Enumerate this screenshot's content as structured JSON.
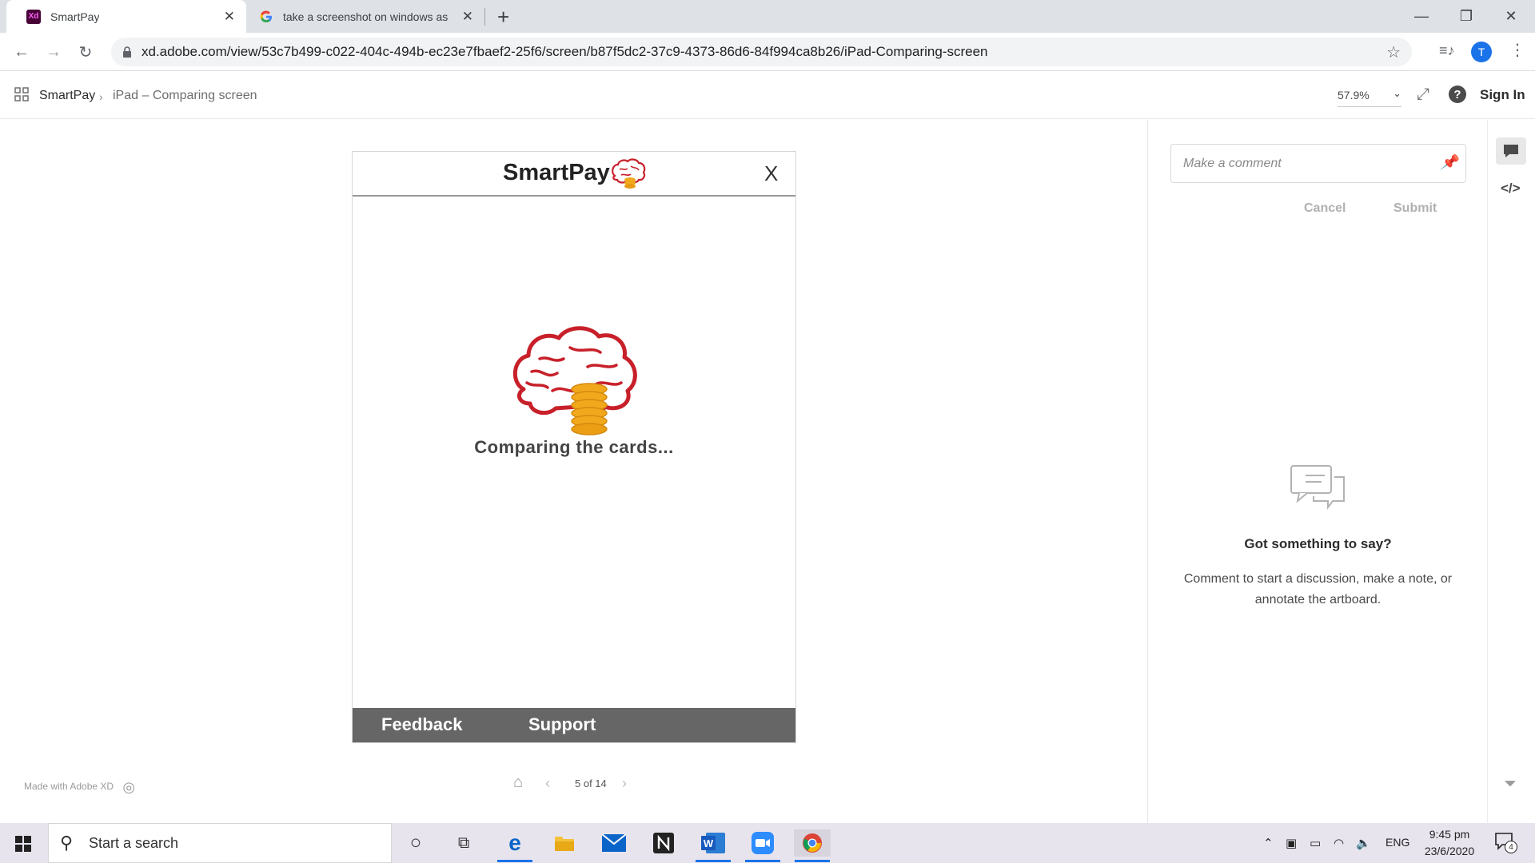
{
  "browser": {
    "tabs": [
      {
        "title": "SmartPay",
        "favicon": "Xd"
      },
      {
        "title": "take a screenshot on windows as",
        "favicon": "google-icon"
      }
    ],
    "url": "xd.adobe.com/view/53c7b499-c022-404c-494b-ec23e7fbaef2-25f6/screen/b87f5dc2-37c9-4373-86d6-84f994ca8b26/iPad-Comparing-screen",
    "profile_initial": "T"
  },
  "xd": {
    "breadcrumb": {
      "root": "SmartPay",
      "current": "iPad – Comparing screen"
    },
    "zoom": "57.9%",
    "sign_in": "Sign In",
    "made_with": "Made with Adobe XD",
    "pager": "5 of 14"
  },
  "artboard": {
    "title": "SmartPay",
    "close": "X",
    "status": "Comparing the cards...",
    "footer": {
      "feedback": "Feedback",
      "support": "Support"
    }
  },
  "comments": {
    "placeholder": "Make a comment",
    "cancel": "Cancel",
    "submit": "Submit",
    "empty_title": "Got something to say?",
    "empty_desc": "Comment to start a discussion, make a note, or annotate the artboard."
  },
  "taskbar": {
    "search": "Start a search",
    "lang": "ENG",
    "time": "9:45 pm",
    "date": "23/6/2020",
    "notifications": "4"
  },
  "colors": {
    "brain_red": "#c8202a",
    "coin_gold": "#f2a81d",
    "footer_gray": "#666666",
    "chrome_tabstrip": "#dee1e6"
  }
}
